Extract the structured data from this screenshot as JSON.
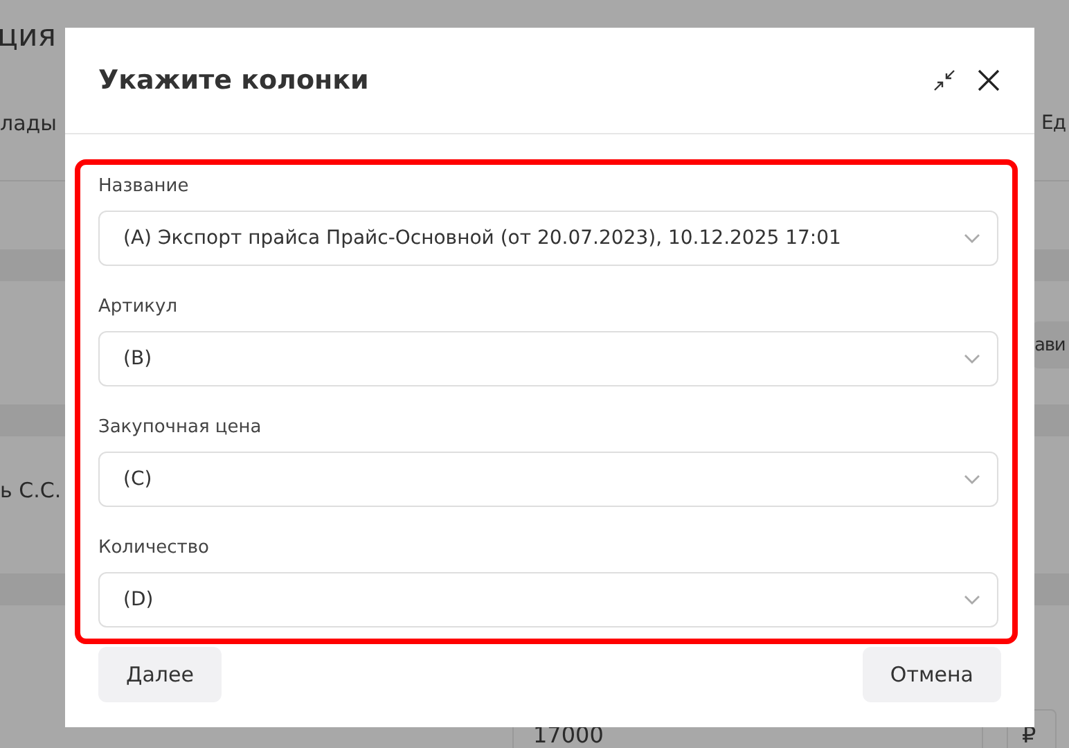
{
  "background": {
    "title_fragment": "ция",
    "column_left": "лады",
    "column_right": "Ед",
    "button_fragment": "ави",
    "person_fragment": "ь С.С.",
    "price_value": "17000",
    "currency": "₽"
  },
  "dialog": {
    "title": "Укажите колонки",
    "fields": [
      {
        "label": "Название",
        "value": "(A) Экспорт прайса Прайс-Основной (от 20.07.2023), 10.12.2025 17:01"
      },
      {
        "label": "Артикул",
        "value": "(B)"
      },
      {
        "label": "Закупочная цена",
        "value": "(C)"
      },
      {
        "label": "Количество",
        "value": "(D)"
      }
    ],
    "buttons": {
      "next": "Далее",
      "cancel": "Отмена"
    }
  }
}
